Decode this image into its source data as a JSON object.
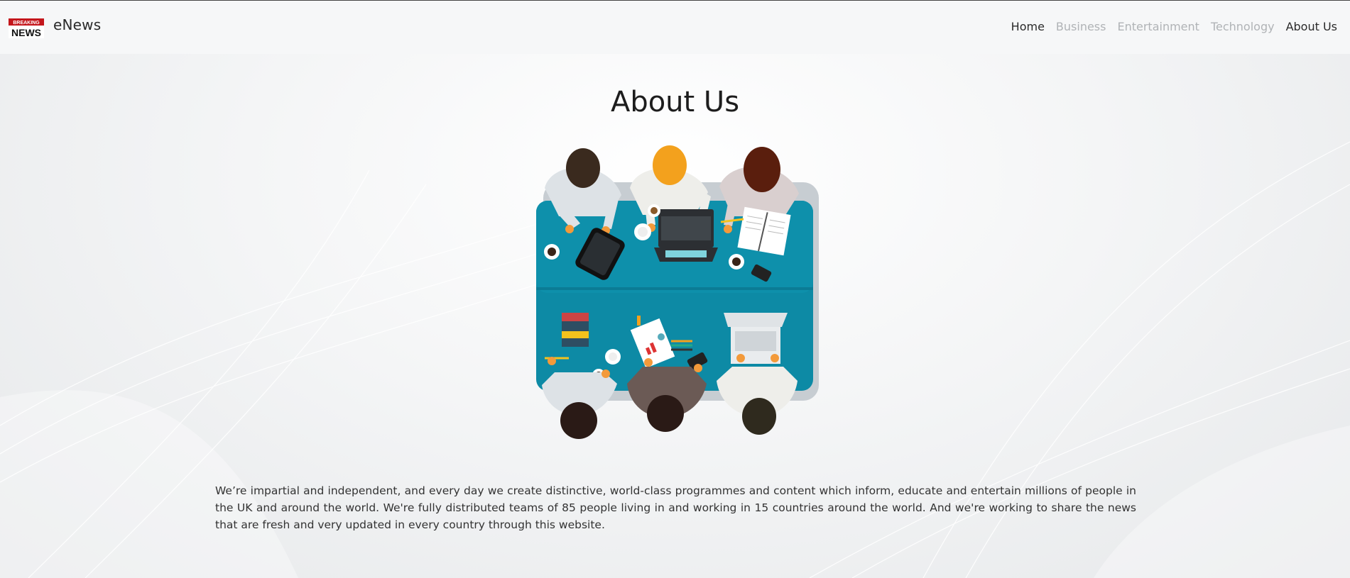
{
  "header": {
    "logo_text": "BREAKING NEWS",
    "brand": "eNews",
    "nav": [
      "Home",
      "Business",
      "Entertainment",
      "Technology",
      "About Us"
    ]
  },
  "main": {
    "title": "About Us",
    "paragraph": "We’re impartial and independent, and every day we create distinctive, world-class programmes and content which inform, educate and entertain millions of people in the UK and around the world. We're fully distributed teams of 85 people living in and working in 15 countries around the world. And we're working to share the news that are fresh and very updated in every country through this website."
  },
  "colors": {
    "table": "#0d8aa5",
    "accent_text": "#2a2a2a",
    "muted_nav": "#b0b3b6",
    "logo_red": "#c4161c"
  },
  "icons": {
    "logo": "breaking-news-logo",
    "illustration": "team-meeting-illustration"
  }
}
